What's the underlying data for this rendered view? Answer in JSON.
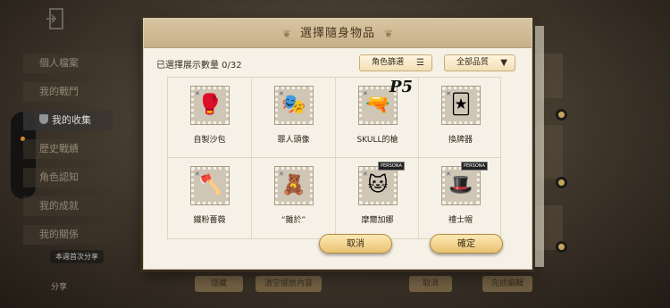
{
  "background": {
    "sidebar": {
      "items": [
        {
          "label": "個人檔案"
        },
        {
          "label": "我的戰鬥"
        },
        {
          "label": "我的收集"
        },
        {
          "label": "歷史戰績"
        },
        {
          "label": "角色認知"
        },
        {
          "label": "我的成就"
        },
        {
          "label": "我的關係"
        }
      ],
      "active_index": 2
    },
    "share_hint": "本週首次分享",
    "share_label": "分享",
    "bottom_buttons": [
      "隱藏",
      "清空擺放內容",
      "取消",
      "完成編輯"
    ]
  },
  "dialog": {
    "title": "選擇隨身物品",
    "count_label": "已選擇展示數量 0/32",
    "filter_role_label": "角色篩選",
    "filter_quality_label": "全部品質",
    "items": [
      {
        "label": "自製沙包",
        "icon": "sandbag-icon",
        "glyph": "🥊",
        "tag": ""
      },
      {
        "label": "罪人頭像",
        "icon": "sinner-portrait-icon",
        "glyph": "🎭",
        "tag": ""
      },
      {
        "label": "SKULL的槍",
        "icon": "skull-gun-icon",
        "glyph": "🔫",
        "tag": ""
      },
      {
        "label": "換牌器",
        "icon": "card-switcher-icon",
        "glyph": "🃏",
        "tag": ""
      },
      {
        "label": "鐵粉薔薇",
        "icon": "shovel-rose-icon",
        "glyph": "🪓",
        "tag": ""
      },
      {
        "label": "“雜於”",
        "icon": "plush-bundle-icon",
        "glyph": "🧸",
        "tag": ""
      },
      {
        "label": "摩爾加娜",
        "icon": "plush-doll-icon",
        "glyph": "🐱",
        "tag": "PERSONA"
      },
      {
        "label": "禮士帽",
        "icon": "top-hat-icon",
        "glyph": "🎩",
        "tag": "PERSONA"
      }
    ],
    "p5_logo": "P5",
    "cancel_label": "取消",
    "confirm_label": "確定"
  }
}
